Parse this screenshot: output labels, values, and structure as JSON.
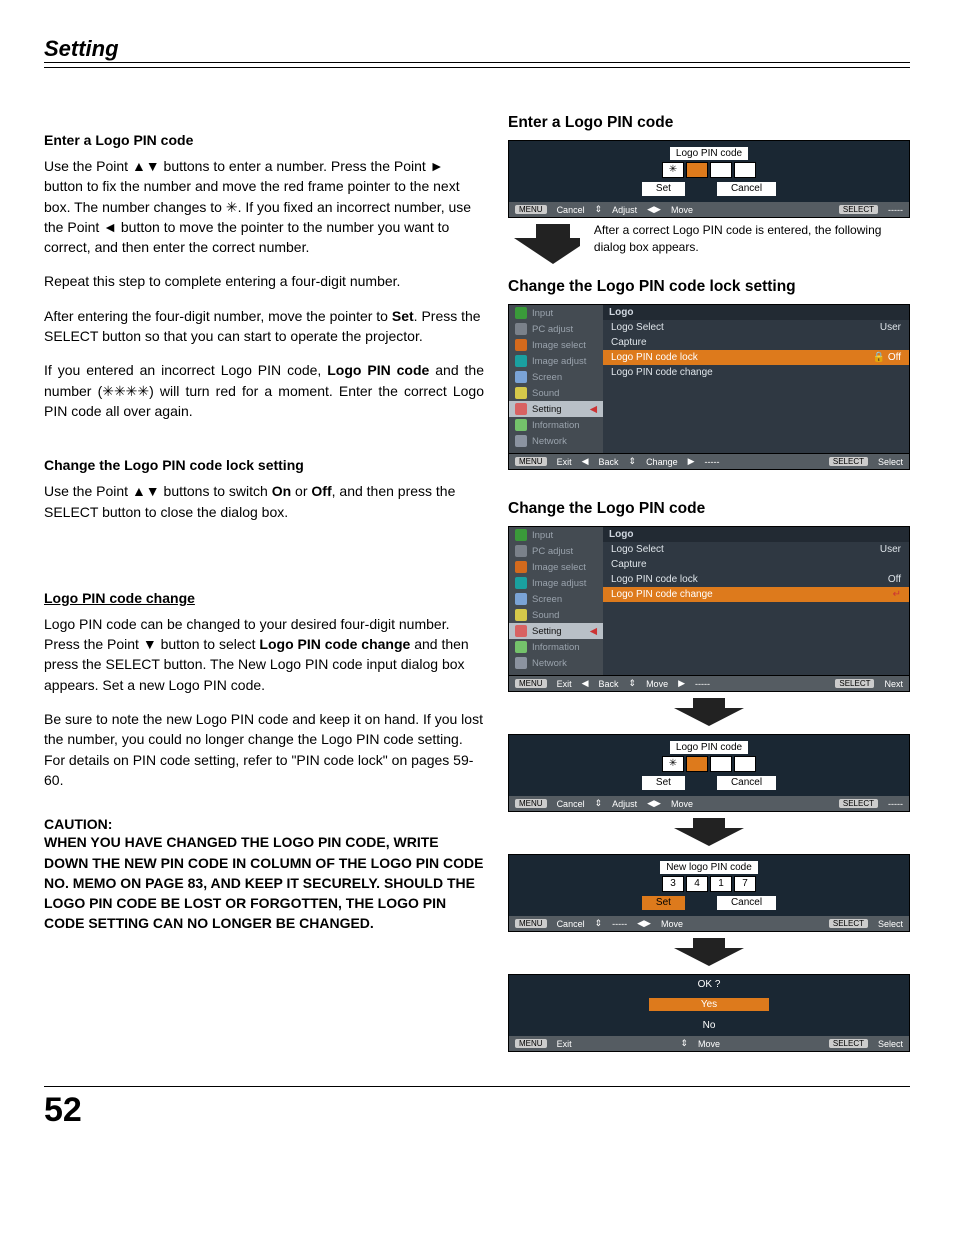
{
  "chapter": "Setting",
  "page_num": "52",
  "left": {
    "h1": "Enter a Logo PIN code",
    "p1": "Use the Point ▲▼ buttons to enter a number. Press the Point ► button to fix the number and move the red frame pointer to the next box. The number changes to ✳. If you fixed an incorrect number, use the Point ◄ button to move the pointer to the number you want to correct, and then enter the correct number.",
    "p2": "Repeat this step to complete entering a four-digit number.",
    "p3a": "After entering the four-digit number, move the pointer to ",
    "p3b": "Set",
    "p3c": ". Press the SELECT button so that you can start to operate the projector.",
    "p4a": "If you entered an incorrect Logo PIN code, ",
    "p4b": "Logo PIN code",
    "p4c": " and the number (✳✳✳✳) will turn red for a moment. Enter the correct Logo PIN code all over again.",
    "h2": "Change the Logo PIN code lock setting",
    "p5a": "Use the Point ▲▼ buttons to switch ",
    "p5b": "On",
    "p5c": " or ",
    "p5d": "Off",
    "p5e": ", and then press the SELECT button to close the dialog box.",
    "h3": "Logo PIN code change",
    "p6a": "Logo PIN code can be changed to your desired four-digit number. Press the Point ▼ button to select ",
    "p6b": "Logo PIN code change",
    "p6c": " and then press the SELECT button. The New Logo PIN code input dialog box appears. Set a new Logo PIN code.",
    "p7": "Be sure to note the new Logo PIN code and keep it on hand. If you lost the number, you could no longer change the Logo PIN code setting. For details on PIN code setting, refer to \"PIN code lock\" on pages 59-60.",
    "caution_label": "CAUTION:",
    "caution_body": "WHEN YOU HAVE CHANGED THE LOGO PIN CODE, WRITE DOWN THE NEW PIN CODE IN COLUMN OF THE LOGO PIN CODE NO. MEMO ON PAGE 83, AND KEEP IT SECURELY. SHOULD THE LOGO PIN CODE BE LOST OR FORGOTTEN, THE LOGO PIN CODE SETTING CAN NO LONGER BE CHANGED."
  },
  "right": {
    "sec1_title": "Enter a Logo PIN code",
    "pin_title": "Logo PIN code",
    "pin_star": "✳",
    "set": "Set",
    "cancel": "Cancel",
    "bar": {
      "menu": "MENU",
      "cancel": "Cancel",
      "adjust": "Adjust",
      "move": "Move",
      "select": "SELECT",
      "dashes": "-----",
      "exit": "Exit",
      "back": "Back",
      "change": "Change",
      "movev": "Move",
      "next": "Next",
      "selectw": "Select"
    },
    "triangles": {
      "upDown": "⇕",
      "leftRight": "◀▶",
      "left": "◀",
      "right": "▶"
    },
    "caption": "After a correct Logo PIN code is entered, the following dialog box appears.",
    "sec2_title": "Change the Logo PIN code lock setting",
    "sidebar": [
      "Input",
      "PC adjust",
      "Image select",
      "Image adjust",
      "Screen",
      "Sound",
      "Setting",
      "Information",
      "Network"
    ],
    "icon_colors": [
      "#3a9a3a",
      "#7a818a",
      "#d36a1d",
      "#1aa0a0",
      "#7aa3d6",
      "#d5c84a",
      "#d86262",
      "#74c26b",
      "#8b93a0"
    ],
    "logo_panel_title": "Logo",
    "logo_items": [
      "Logo Select",
      "Capture",
      "Logo PIN code lock",
      "Logo PIN code change"
    ],
    "user": "User",
    "off": "Off",
    "lock": "🔒",
    "sec3_title": "Change the Logo PIN code",
    "newpin_title": "New logo PIN code",
    "newpin_values": [
      "3",
      "4",
      "1",
      "7"
    ],
    "ok_title": "OK ?",
    "yes": "Yes",
    "no": "No"
  }
}
